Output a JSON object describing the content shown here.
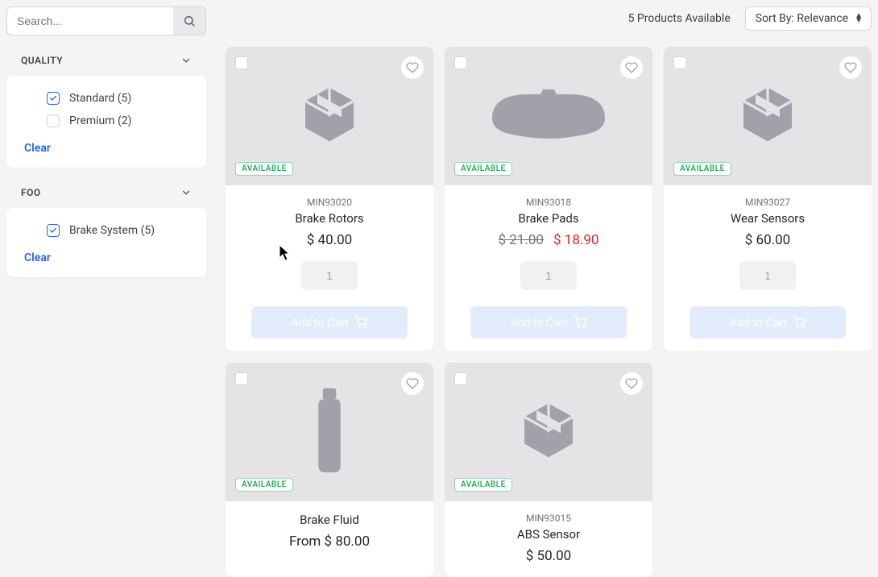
{
  "search": {
    "placeholder": "Search..."
  },
  "filters": [
    {
      "title": "QUALITY",
      "options": [
        {
          "label": "Standard (5)",
          "checked": true
        },
        {
          "label": "Premium (2)",
          "checked": false
        }
      ],
      "clear": "Clear"
    },
    {
      "title": "FOO",
      "options": [
        {
          "label": "Brake System (5)",
          "checked": true
        }
      ],
      "clear": "Clear"
    }
  ],
  "toolbar": {
    "count": "5 Products Available",
    "sort_prefix": "Sort By:",
    "sort_value": "Relevance"
  },
  "add_to_cart_label": "Add to Cart",
  "products": [
    {
      "sku": "MIN93020",
      "name": "Brake Rotors",
      "price": "$ 40.00",
      "badge": "AVAILABLE",
      "qty": "1",
      "img": "box"
    },
    {
      "sku": "MIN93018",
      "name": "Brake Pads",
      "price_old": "$ 21.00",
      "price_sale": "$ 18.90",
      "badge": "AVAILABLE",
      "qty": "1",
      "img": "pad"
    },
    {
      "sku": "MIN93027",
      "name": "Wear Sensors",
      "price": "$ 60.00",
      "badge": "AVAILABLE",
      "qty": "1",
      "img": "box"
    },
    {
      "sku": "",
      "name": "Brake Fluid",
      "price": "From $ 80.00",
      "badge": "AVAILABLE",
      "qty": "1",
      "img": "bottle"
    },
    {
      "sku": "MIN93015",
      "name": "ABS Sensor",
      "price": "$ 50.00",
      "badge": "AVAILABLE",
      "qty": "1",
      "img": "box"
    }
  ]
}
